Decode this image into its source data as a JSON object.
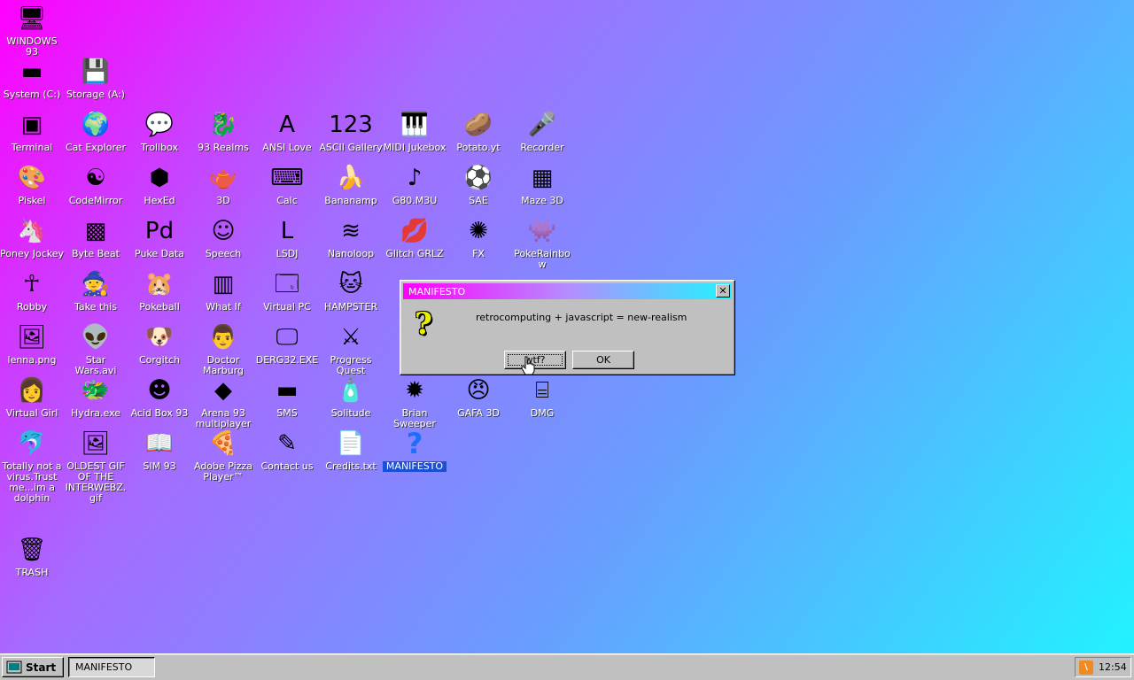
{
  "desktop": {
    "icons": [
      {
        "label": "WINDOWS 93",
        "icon": "computer-icon",
        "glyph": "🖥"
      },
      {
        "label": "System (C:)",
        "icon": "drive-c-icon",
        "glyph": "▬"
      },
      {
        "label": "Storage (A:)",
        "icon": "floppy-drive-icon",
        "glyph": "💾"
      },
      {
        "label": "Terminal",
        "icon": "terminal-icon",
        "glyph": "▣"
      },
      {
        "label": "Cat Explorer",
        "icon": "cat-explorer-icon",
        "glyph": "🌍"
      },
      {
        "label": "Trollbox",
        "icon": "trollbox-icon",
        "glyph": "💬"
      },
      {
        "label": "93 Realms",
        "icon": "realms-icon",
        "glyph": "🐉"
      },
      {
        "label": "ANSI Love",
        "icon": "ansi-love-icon",
        "glyph": "A"
      },
      {
        "label": "ASCII Gallery",
        "icon": "ascii-gallery-icon",
        "glyph": "123"
      },
      {
        "label": "MIDI Jukebox",
        "icon": "midi-jukebox-icon",
        "glyph": "🎹"
      },
      {
        "label": "Potato.yt",
        "icon": "potato-icon",
        "glyph": "🥔"
      },
      {
        "label": "Recorder",
        "icon": "microphone-icon",
        "glyph": "🎤"
      },
      {
        "label": "Piskel",
        "icon": "palette-icon",
        "glyph": "🎨"
      },
      {
        "label": "CodeMirror",
        "icon": "codemirror-icon",
        "glyph": "☯"
      },
      {
        "label": "HexEd",
        "icon": "hexed-cube-icon",
        "glyph": "⬢"
      },
      {
        "label": "3D",
        "icon": "teapot-icon",
        "glyph": "🫖"
      },
      {
        "label": "Calc",
        "icon": "calculator-icon",
        "glyph": "⌨"
      },
      {
        "label": "Bananamp",
        "icon": "banana-icon",
        "glyph": "🍌"
      },
      {
        "label": "G80.M3U",
        "icon": "playlist-file-icon",
        "glyph": "♪"
      },
      {
        "label": "SAE",
        "icon": "checker-ball-icon",
        "glyph": "⚽"
      },
      {
        "label": "Maze 3D",
        "icon": "maze-icon",
        "glyph": "▦"
      },
      {
        "label": "Poney Jockey",
        "icon": "pony-icon",
        "glyph": "🦄"
      },
      {
        "label": "Byte Beat",
        "icon": "byte-beat-icon",
        "glyph": "▩"
      },
      {
        "label": "Puke Data",
        "icon": "puredata-icon",
        "glyph": "Pd"
      },
      {
        "label": "Speech",
        "icon": "speech-face-icon",
        "glyph": "☺"
      },
      {
        "label": "LSDJ",
        "icon": "lsdj-icon",
        "glyph": "L"
      },
      {
        "label": "Nanoloop",
        "icon": "nanoloop-wave-icon",
        "glyph": "≋"
      },
      {
        "label": "Glitch GRLZ",
        "icon": "lips-icon",
        "glyph": "💋"
      },
      {
        "label": "FX",
        "icon": "atom-icon",
        "glyph": "✺"
      },
      {
        "label": "PokeRainbow",
        "icon": "pokerainbow-icon",
        "glyph": "👾"
      },
      {
        "label": "Robby",
        "icon": "stick-figure-icon",
        "glyph": "☥"
      },
      {
        "label": "Take this",
        "icon": "take-this-icon",
        "glyph": "🧙"
      },
      {
        "label": "Pokeball",
        "icon": "pokeball-icon",
        "glyph": "🐹"
      },
      {
        "label": "What If",
        "icon": "what-if-icon",
        "glyph": "▥"
      },
      {
        "label": "Virtual PC",
        "icon": "virtual-pc-icon",
        "glyph": "🗔"
      },
      {
        "label": "HAMPSTER",
        "icon": "hamster-icon",
        "glyph": "🐱"
      },
      {
        "label": "lenna.png",
        "icon": "image-file-icon",
        "glyph": "🖼"
      },
      {
        "label": "Star Wars.avi",
        "icon": "yoda-icon",
        "glyph": "👽"
      },
      {
        "label": "Corgitch",
        "icon": "corgi-icon",
        "glyph": "🐶"
      },
      {
        "label": "Doctor Marburg",
        "icon": "doctor-icon",
        "glyph": "👨"
      },
      {
        "label": "DERG32.EXE",
        "icon": "derg-monitor-icon",
        "glyph": "🖵"
      },
      {
        "label": "Progress Quest",
        "icon": "swords-icon",
        "glyph": "⚔"
      },
      {
        "label": "Virtual Girl",
        "icon": "virtual-girl-icon",
        "glyph": "👩"
      },
      {
        "label": "Hydra.exe",
        "icon": "hydra-icon",
        "glyph": "🐲"
      },
      {
        "label": "Acid Box 93",
        "icon": "smiley-icon",
        "glyph": "☻"
      },
      {
        "label": "Arena 93 multiplayer",
        "icon": "cube-icon",
        "glyph": "◆"
      },
      {
        "label": "SMS",
        "icon": "console-icon",
        "glyph": "▬"
      },
      {
        "label": "Solitude",
        "icon": "bottle-icon",
        "glyph": "🧴"
      },
      {
        "label": "Brian Sweeper",
        "icon": "mine-icon",
        "glyph": "✹"
      },
      {
        "label": "GAFA 3D",
        "icon": "doom-face-icon",
        "glyph": "😠"
      },
      {
        "label": "DMG",
        "icon": "dmg-icon",
        "glyph": "⌸"
      },
      {
        "label": "Totally not a virus.Trust me...im a dolphin",
        "icon": "dolphin-shortcut-icon",
        "glyph": "🐬"
      },
      {
        "label": "OLDEST GIF OF THE INTERWEBZ.gif",
        "icon": "gif-file-icon",
        "glyph": "🖼"
      },
      {
        "label": "SIM 93",
        "icon": "sim-book-icon",
        "glyph": "📖"
      },
      {
        "label": "Adobe Pizza Player™",
        "icon": "pizza-icon",
        "glyph": "🍕"
      },
      {
        "label": "Contact us",
        "icon": "contact-icon",
        "glyph": "✎"
      },
      {
        "label": "Credits.txt",
        "icon": "text-file-icon",
        "glyph": "📄"
      },
      {
        "label": "MANIFESTO",
        "icon": "question-mark-icon",
        "glyph": "?"
      },
      {
        "label": "TRASH",
        "icon": "recycle-bin-icon",
        "glyph": "🗑"
      }
    ]
  },
  "dialog": {
    "title": "MANIFESTO",
    "close_glyph": "✕",
    "icon_glyph": "?",
    "message": "retrocomputing + javascript = new-realism",
    "button_wtf": "wtf?",
    "button_ok": "OK"
  },
  "taskbar": {
    "start_label": "Start",
    "task_label": "MANIFESTO",
    "tray_icon_glyph": "\\",
    "time": "12:54"
  }
}
